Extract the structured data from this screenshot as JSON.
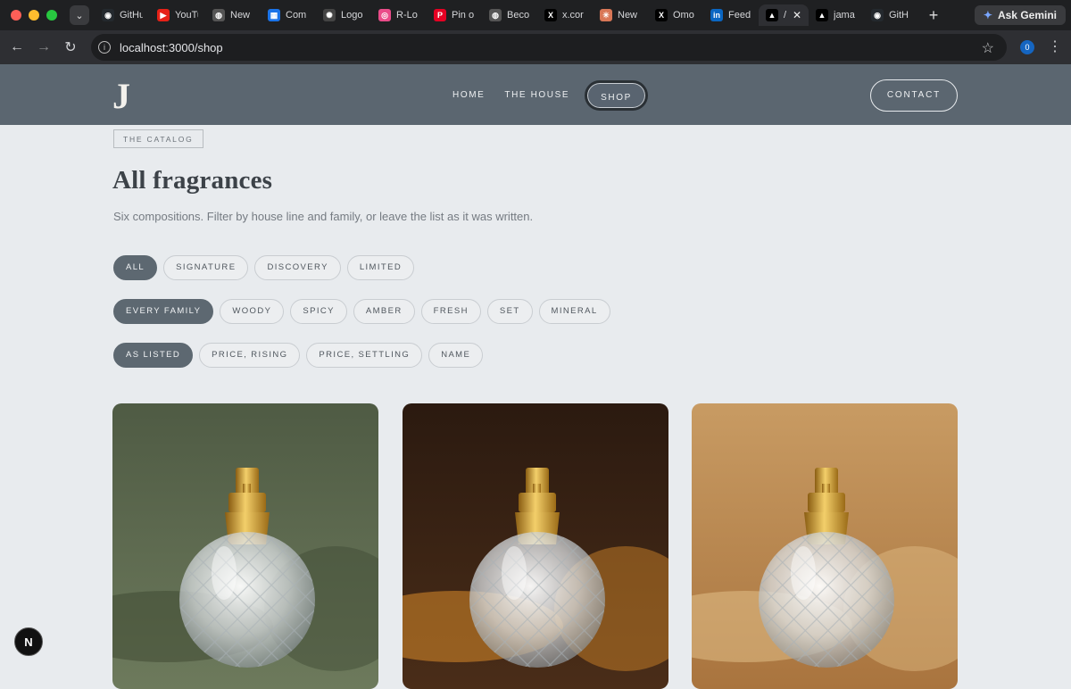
{
  "browser": {
    "tabs": [
      {
        "title": "GitHub",
        "icon": "github-icon",
        "fav_bg": "#24292e",
        "glyph": "◉"
      },
      {
        "title": "YouTube",
        "icon": "youtube-icon",
        "fav_bg": "#e62117",
        "glyph": "▶"
      },
      {
        "title": "New",
        "icon": "globe-icon",
        "fav_bg": "#555",
        "glyph": "◍"
      },
      {
        "title": "Com",
        "icon": "grid-icon",
        "fav_bg": "#1a73e8",
        "glyph": "▦"
      },
      {
        "title": "Logo",
        "icon": "openai-icon",
        "fav_bg": "#444",
        "glyph": "✺"
      },
      {
        "title": "R-Lo",
        "icon": "dribbble-icon",
        "fav_bg": "#ea4c89",
        "glyph": "◎"
      },
      {
        "title": "Pin o",
        "icon": "pinterest-icon",
        "fav_bg": "#e60023",
        "glyph": "P"
      },
      {
        "title": "Beco",
        "icon": "globe-icon",
        "fav_bg": "#555",
        "glyph": "◍"
      },
      {
        "title": "x.cor",
        "icon": "x-icon",
        "fav_bg": "#000",
        "glyph": "X"
      },
      {
        "title": "New",
        "icon": "claude-icon",
        "fav_bg": "#d97757",
        "glyph": "✳"
      },
      {
        "title": "Omo",
        "icon": "x-icon",
        "fav_bg": "#000",
        "glyph": "X"
      },
      {
        "title": "Feed",
        "icon": "linkedin-icon",
        "fav_bg": "#0a66c2",
        "glyph": "in"
      },
      {
        "title": "/",
        "icon": "vercel-icon",
        "fav_bg": "#000",
        "glyph": "▲",
        "active": true
      },
      {
        "title": "jama",
        "icon": "vercel-icon",
        "fav_bg": "#000",
        "glyph": "▲"
      },
      {
        "title": "GitH",
        "icon": "github-icon",
        "fav_bg": "#24292e",
        "glyph": "◉"
      }
    ],
    "gemini_label": "Ask Gemini",
    "url": "localhost:3000/shop",
    "ext_badge": "0"
  },
  "site": {
    "logo": "J",
    "nav": [
      "HOME",
      "THE HOUSE",
      "SHOP"
    ],
    "contact": "CONTACT"
  },
  "page": {
    "eyebrow": "THE CATALOG",
    "title": "All fragrances",
    "lede": "Six compositions. Filter by house line and family, or leave the list as it was written.",
    "line_filters": [
      "ALL",
      "SIGNATURE",
      "DISCOVERY",
      "LIMITED"
    ],
    "family_filters": [
      "EVERY FAMILY",
      "WOODY",
      "SPICY",
      "AMBER",
      "FRESH",
      "SET",
      "MINERAL"
    ],
    "sort_filters": [
      "AS LISTED",
      "PRICE, RISING",
      "PRICE, SETTLING",
      "NAME"
    ]
  },
  "products": [
    {
      "theme": "woody",
      "bg_top": "#4f5b44",
      "bg_bot": "#6d7a5c",
      "accent": "#3f4a33"
    },
    {
      "theme": "spicy",
      "bg_top": "#2b1a10",
      "bg_bot": "#4a2d18",
      "accent": "#d98b2a"
    },
    {
      "theme": "amber",
      "bg_top": "#c89b63",
      "bg_bot": "#a9743e",
      "accent": "#e2bf88"
    }
  ],
  "dev_badge": "N"
}
